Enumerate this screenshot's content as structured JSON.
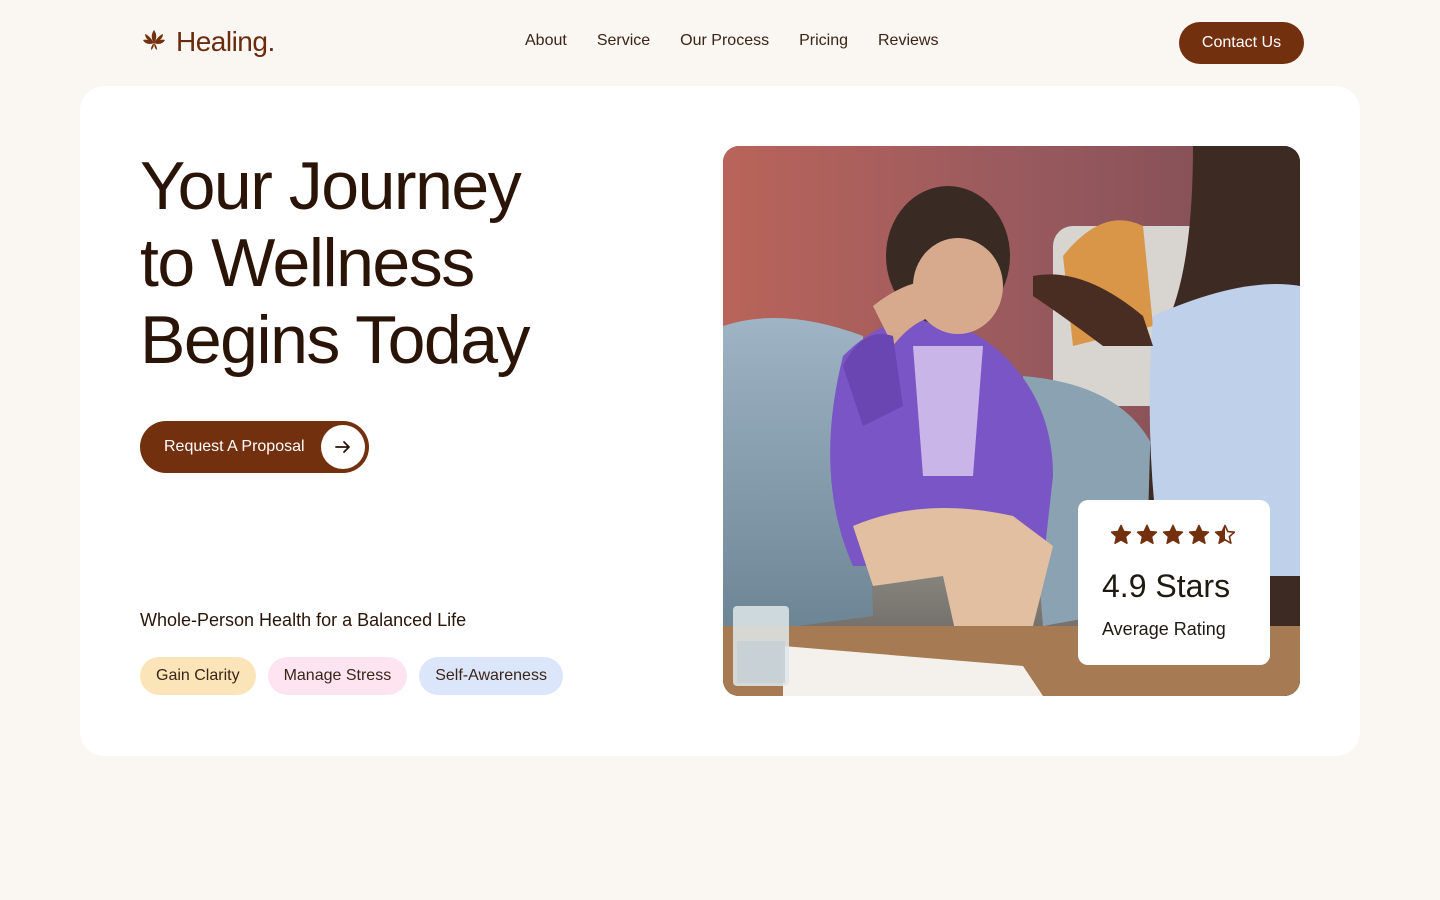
{
  "brand": {
    "name": "Healing.",
    "icon": "lotus-icon",
    "color": "#73300e"
  },
  "nav": {
    "links": [
      "About",
      "Service",
      "Our Process",
      "Pricing",
      "Reviews"
    ],
    "contact_label": "Contact Us"
  },
  "hero": {
    "headline_lines": [
      "Your Journey",
      "to Wellness",
      "Begins Today"
    ],
    "cta_label": "Request A Proposal",
    "cta_icon": "arrow-right-icon",
    "tagline": "Whole-Person Health for a Balanced Life",
    "pills": [
      "Gain Clarity",
      "Manage Stress",
      "Self-Awareness"
    ]
  },
  "rating": {
    "stars": 4.5,
    "max_stars": 5,
    "value_text": "4.9 Stars",
    "label": "Average Rating"
  },
  "colors": {
    "background": "#faf6f1",
    "accent": "#73300e",
    "pill_yellow": "#fbe5b8",
    "pill_pink": "#fde4f0",
    "pill_blue": "#dce6fb"
  }
}
